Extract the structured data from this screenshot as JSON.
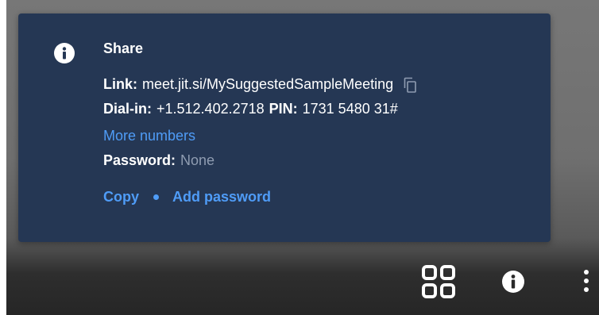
{
  "share": {
    "title": "Share",
    "link_label": "Link:",
    "link_value": "meet.jit.si/MySuggestedSampleMeeting",
    "dialin_label": "Dial-in:",
    "dialin_number": "+1.512.402.2718",
    "pin_label": "PIN:",
    "pin_value": "1731 5480 31#",
    "more_numbers": "More numbers",
    "password_label": "Password:",
    "password_value": "None",
    "copy_action": "Copy",
    "add_password_action": "Add password"
  },
  "icons": {
    "dialog": "info-icon",
    "link_copy": "copy-icon",
    "toolbar": [
      "tile-view-icon",
      "info-icon",
      "more-options-icon"
    ]
  },
  "colors": {
    "dialog_background": "#253754",
    "link_color": "#4f9cf7",
    "muted_text": "#8f9cb1",
    "text": "#ffffff"
  }
}
